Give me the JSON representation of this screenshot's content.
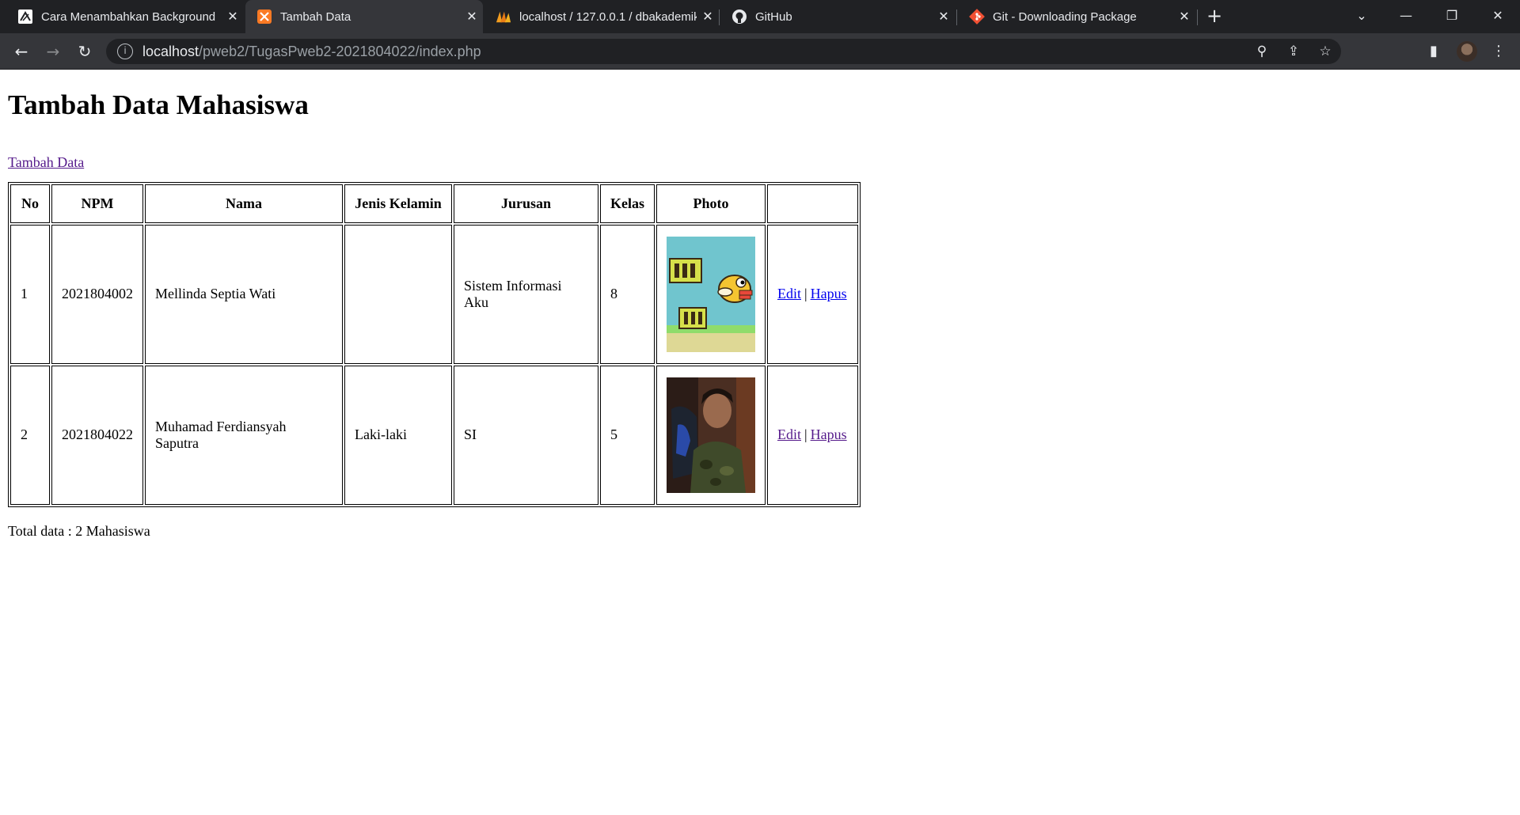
{
  "browser": {
    "tabs": [
      {
        "title": "Cara Menambahkan Background",
        "active": false
      },
      {
        "title": "Tambah Data",
        "active": true
      },
      {
        "title": "localhost / 127.0.0.1 / dbakademik",
        "active": false
      },
      {
        "title": "GitHub",
        "active": false
      },
      {
        "title": "Git - Downloading Package",
        "active": false
      }
    ],
    "url_host": "localhost",
    "url_path": "/pweb2/TugasPweb2-2021804022/index.php"
  },
  "page": {
    "heading": "Tambah Data Mahasiswa",
    "add_link": "Tambah Data",
    "total_text": "Total data : 2 Mahasiswa"
  },
  "table": {
    "headers": [
      "No",
      "NPM",
      "Nama",
      "Jenis Kelamin",
      "Jurusan",
      "Kelas",
      "Photo",
      ""
    ],
    "rows": [
      {
        "no": "1",
        "npm": "2021804002",
        "nama": "Mellinda Septia Wati",
        "jenis_kelamin": "",
        "jurusan": "Sistem Informasi Aku",
        "kelas": "8",
        "photo": "flappy-bird-image",
        "edit": "Edit",
        "hapus": "Hapus"
      },
      {
        "no": "2",
        "npm": "2021804022",
        "nama": "Muhamad Ferdiansyah Saputra",
        "jenis_kelamin": "Laki-laki",
        "jurusan": "SI",
        "kelas": "5",
        "photo": "student-portrait-image",
        "edit": "Edit",
        "hapus": "Hapus"
      }
    ],
    "separator": "|"
  },
  "colors": {
    "chrome_dark": "#202124",
    "chrome_tab_active": "#35363a",
    "link_visited": "#551a8b",
    "link_unvisited": "#0000ee"
  }
}
